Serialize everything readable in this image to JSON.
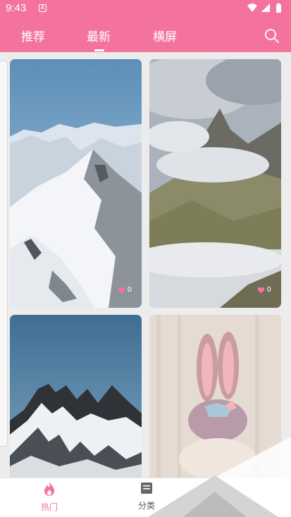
{
  "status_bar": {
    "time": "9:43",
    "notification": "A"
  },
  "tabs": [
    {
      "label": "推荐",
      "active": false
    },
    {
      "label": "最新",
      "active": true
    },
    {
      "label": "横屏",
      "active": false
    }
  ],
  "cards": [
    {
      "likes": "0"
    },
    {
      "likes": "0"
    }
  ],
  "bottom_nav": [
    {
      "label": "热门",
      "icon": "fire-icon",
      "active": true
    },
    {
      "label": "分类",
      "icon": "category-icon",
      "active": false
    }
  ],
  "colors": {
    "accent": "#f4739d",
    "background": "#ececec"
  }
}
